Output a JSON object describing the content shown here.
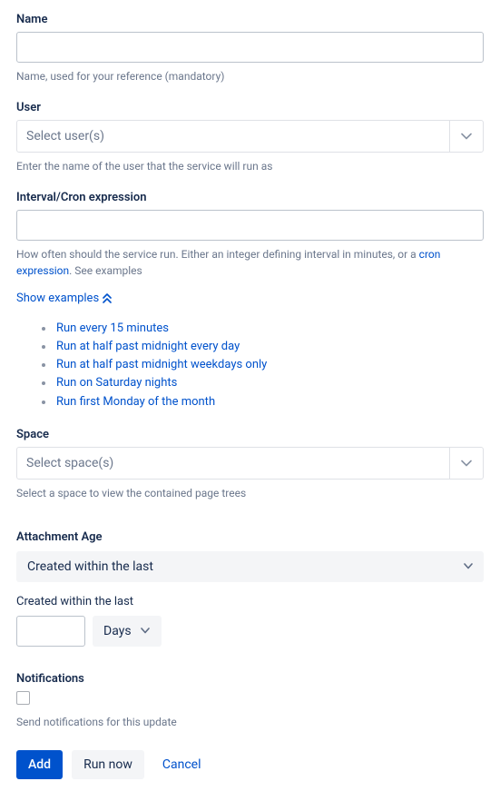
{
  "name": {
    "label": "Name",
    "value": "",
    "help": "Name, used for your reference (mandatory)"
  },
  "user": {
    "label": "User",
    "placeholder": "Select user(s)",
    "help": "Enter the name of the user that the service will run as"
  },
  "interval": {
    "label": "Interval/Cron expression",
    "value": "",
    "help_prefix": "How often should the service run. Either an integer defining interval in minutes, or a ",
    "cron_link": "cron expression",
    "help_suffix": ". See examples",
    "show_examples": "Show examples",
    "examples": [
      "Run every 15 minutes",
      "Run at half past midnight every day",
      "Run at half past midnight weekdays only",
      "Run on Saturday nights",
      "Run first Monday of the month"
    ]
  },
  "space": {
    "label": "Space",
    "placeholder": "Select space(s)",
    "help": "Select a space to view the contained page trees"
  },
  "attachment_age": {
    "label": "Attachment Age",
    "selected": "Created within the last",
    "sublabel": "Created within the last",
    "duration_value": "",
    "duration_unit": "Days"
  },
  "notifications": {
    "label": "Notifications",
    "checked": false,
    "help": "Send notifications for this update"
  },
  "actions": {
    "add": "Add",
    "run_now": "Run now",
    "cancel": "Cancel"
  }
}
